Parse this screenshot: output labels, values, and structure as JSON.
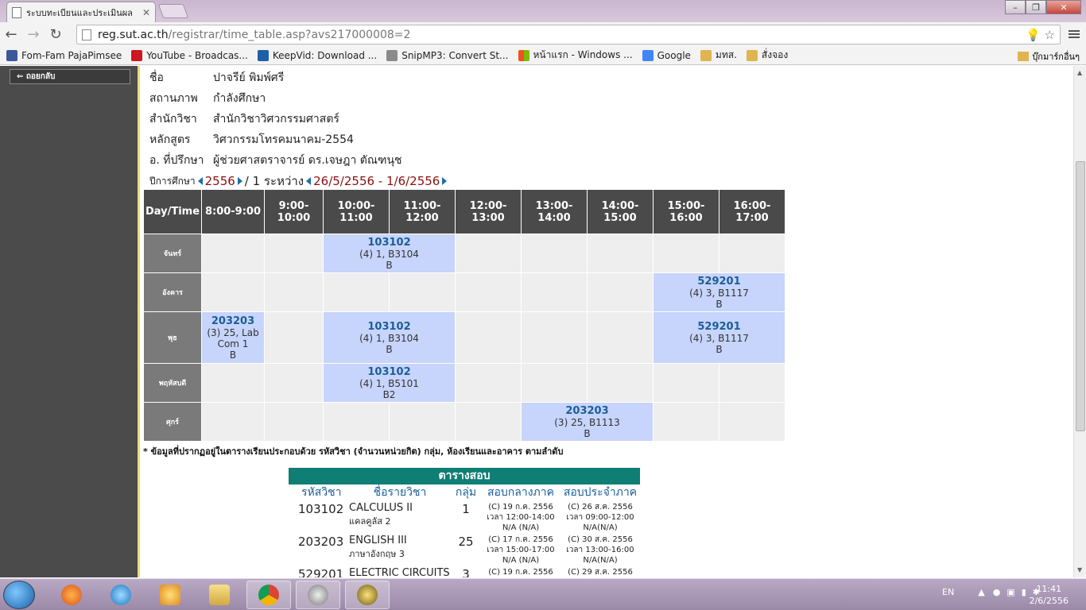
{
  "browser": {
    "tab_title": "ระบบทะเบียนและประเมินผล",
    "url_host": "reg.sut.ac.th",
    "url_path": "/registrar/time_table.asp?avs217000008=2",
    "bookmarks": [
      {
        "label": "Fom-Fam PajaPimsee",
        "color": "#3b5998"
      },
      {
        "label": "YouTube - Broadcas...",
        "color": "#cc181e"
      },
      {
        "label": "KeepVid: Download ...",
        "color": "#1f5fa8"
      },
      {
        "label": "SnipMP3: Convert St...",
        "color": "#8a8a8a"
      },
      {
        "label": "หน้าแรก - Windows ...",
        "color": "#f25022"
      },
      {
        "label": "Google",
        "color": "#4285f4"
      },
      {
        "label": "มทส.",
        "color": "#e0b450"
      },
      {
        "label": "สั่งจอง",
        "color": "#e0b450"
      }
    ],
    "other_bookmarks": "บุ๊กมาร์กอื่นๆ"
  },
  "sidebar": {
    "back_label": "ถอยกลับ"
  },
  "student": {
    "name_label": "ชื่อ",
    "name_value": "ปาจรีย์ พิมพ์ศรี",
    "status_label": "สถานภาพ",
    "status_value": "กำลังศึกษา",
    "school_label": "สำนักวิชา",
    "school_value": "สำนักวิชาวิศวกรรมศาสตร์",
    "program_label": "หลักสูตร",
    "program_value": "วิศวกรรมโทรคมนาคม-2554",
    "advisor_label": "อ. ที่ปรึกษา",
    "advisor_value": "ผู้ช่วยศาสตราจารย์ ดร.เจษฎา ตัณฑนุช"
  },
  "term": {
    "year_label": "ปีการศึกษา",
    "year": "2556",
    "semester": "/ 1",
    "between_label": "ระหว่าง",
    "range": "26/5/2556 - 1/6/2556"
  },
  "timetable": {
    "header": [
      "Day/Time",
      "8:00-9:00",
      "9:00-10:00",
      "10:00-11:00",
      "11:00-12:00",
      "12:00-13:00",
      "13:00-14:00",
      "14:00-15:00",
      "15:00-16:00",
      "16:00-17:00"
    ],
    "days": [
      "จันทร์",
      "อังคาร",
      "พุธ",
      "พฤหัสบดี",
      "ศุกร์"
    ],
    "entries": {
      "mon_1": {
        "code": "103102",
        "detail": "(4) 1, B3104",
        "bldg": "B"
      },
      "tue_1": {
        "code": "529201",
        "detail": "(4) 3, B1117",
        "bldg": "B"
      },
      "wed_1": {
        "code": "203203",
        "detail": "(3) 25, Lab Com 1",
        "bldg": "B"
      },
      "wed_2": {
        "code": "103102",
        "detail": "(4) 1, B3104",
        "bldg": "B"
      },
      "wed_3": {
        "code": "529201",
        "detail": "(4) 3, B1117",
        "bldg": "B"
      },
      "thu_1": {
        "code": "103102",
        "detail": "(4) 1, B5101",
        "bldg": "B2"
      },
      "fri_1": {
        "code": "203203",
        "detail": "(3) 25, B1113",
        "bldg": "B"
      }
    }
  },
  "note": "* ข้อมูลที่ปรากฏอยู่ในตารางเรียนประกอบด้วย รหัสวิชา (จำนวนหน่วยกิต) กลุ่ม, ห้องเรียนและอาคาร ตามลำดับ",
  "exam": {
    "title": "ตารางสอบ",
    "columns": [
      "รหัสวิชา",
      "ชื่อรายวิชา",
      "กลุ่ม",
      "สอบกลางภาค",
      "สอบประจำภาค"
    ],
    "rows": [
      {
        "code": "103102",
        "name_en": "CALCULUS II",
        "name_th": "แคลคูลัส 2",
        "group": "1",
        "mid": [
          "(C) 19 ก.ค. 2556",
          "เวลา 12:00-14:00",
          "N/A (N/A)"
        ],
        "final": [
          "(C) 26 ส.ค. 2556",
          "เวลา 09:00-12:00",
          "N/A(N/A)"
        ]
      },
      {
        "code": "203203",
        "name_en": "ENGLISH III",
        "name_th": "ภาษาอังกฤษ 3",
        "group": "25",
        "mid": [
          "(C) 17 ก.ค. 2556",
          "เวลา 15:00-17:00",
          "N/A (N/A)"
        ],
        "final": [
          "(C) 30 ส.ค. 2556",
          "เวลา 13:00-16:00",
          "N/A(N/A)"
        ]
      },
      {
        "code": "529201",
        "name_en": "ELECTRIC CIRCUITS",
        "name_th": "",
        "group": "3",
        "mid": [
          "(C) 19 ก.ค. 2556",
          "",
          ""
        ],
        "final": [
          "(C) 29 ส.ค. 2556",
          "",
          ""
        ]
      }
    ]
  },
  "taskbar": {
    "lang": "EN",
    "time": "11:41",
    "date": "2/6/2556"
  }
}
